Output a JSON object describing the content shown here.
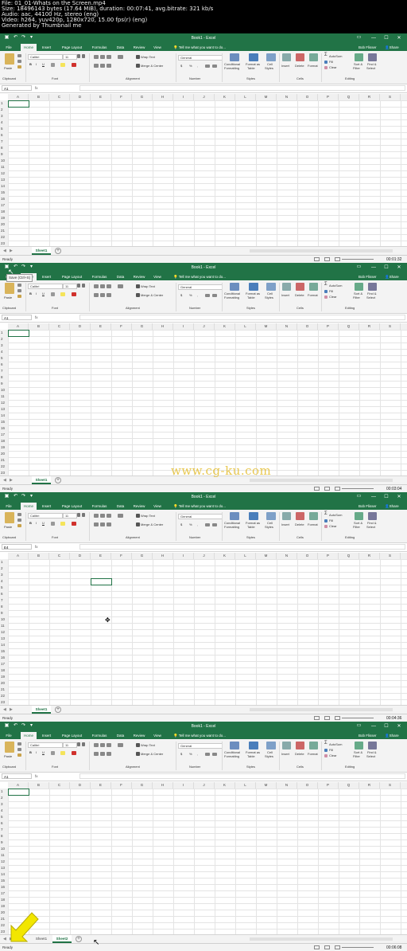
{
  "meta": {
    "lines": [
      "File: 01_01-Whats on the Screen.mp4",
      "Size: 18496143 bytes (17.64 MiB), duration: 00:07:41, avg.bitrate: 321 kb/s",
      "Audio: aac, 44100 Hz, stereo (eng)",
      "Video: h264, yuv420p, 1280x720, 15.00 fps(r) (eng)",
      "Generated by Thumbnail me"
    ]
  },
  "app": {
    "title": "Book1 - Excel",
    "user": "Bob Flisser",
    "share": "Share",
    "tell_me": "Tell me what you want to do...",
    "window_controls": [
      "—",
      "☐",
      "✕"
    ]
  },
  "tabs": [
    "File",
    "Home",
    "Insert",
    "Page Layout",
    "Formulas",
    "Data",
    "Review",
    "View"
  ],
  "ribbon": {
    "paste": "Paste",
    "font_name": "Calibri",
    "font_size": "11",
    "wrap_text": "Wrap Text",
    "merge_center": "Merge & Center",
    "number_format": "General",
    "dollar": "$",
    "percent": "%",
    "comma": ",",
    "conditional": "Conditional",
    "formatting": "Formatting",
    "format_as": "Format as",
    "table": "Table",
    "cell": "Cell",
    "styles_label": "Styles",
    "insert": "Insert",
    "delete": "Delete",
    "format": "Format",
    "autosum": "AutoSum",
    "fill": "Fill",
    "clear": "Clear",
    "sort_filter": "Sort &",
    "filter": "Filter",
    "find_select": "Find &",
    "select": "Select",
    "bold": "B",
    "italic": "I",
    "underline": "U",
    "groups": {
      "clipboard": "Clipboard",
      "font": "Font",
      "alignment": "Alignment",
      "number": "Number",
      "styles": "Styles",
      "cells": "Cells",
      "editing": "Editing"
    }
  },
  "fx": "fx",
  "columns": [
    "A",
    "B",
    "C",
    "D",
    "E",
    "F",
    "G",
    "H",
    "I",
    "J",
    "K",
    "L",
    "M",
    "N",
    "O",
    "P",
    "Q",
    "R",
    "S"
  ],
  "rows": [
    "1",
    "2",
    "3",
    "4",
    "5",
    "6",
    "7",
    "8",
    "9",
    "10",
    "11",
    "12",
    "13",
    "14",
    "15",
    "16",
    "17",
    "18",
    "19",
    "20",
    "21",
    "22",
    "23",
    "24",
    "25",
    "26",
    "27"
  ],
  "status": {
    "ready": "Ready"
  },
  "new_sheet": "+",
  "frames": [
    {
      "namebox": "A1",
      "sheets": [
        "Sheet1"
      ],
      "timestamp": "00:01:32"
    },
    {
      "namebox": "A1",
      "sheets": [
        "Sheet1"
      ],
      "timestamp": "00:03:04",
      "tooltip": "Save (Ctrl+S)"
    },
    {
      "namebox": "E4",
      "sheets": [
        "Sheet1"
      ],
      "timestamp": "00:04:36"
    },
    {
      "namebox": "A1",
      "sheets": [
        "Sheet1",
        "Sheet2"
      ],
      "timestamp": "00:06:08"
    }
  ],
  "watermark": "www.cg-ku.com",
  "colors": {
    "excel_green": "#217346",
    "arrow_yellow": "#f2e600"
  }
}
